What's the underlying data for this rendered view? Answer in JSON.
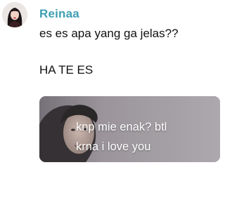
{
  "post": {
    "author": {
      "name": "Reinaa",
      "name_color": "#3d9fb0",
      "avatar_icon": "user-avatar"
    },
    "text_lines": [
      "es es apa yang ga jelas??",
      "HA TE ES"
    ],
    "media": {
      "type": "video-thumbnail",
      "caption_lines": [
        "knp mie enak? btl",
        "krna i love you"
      ]
    }
  }
}
